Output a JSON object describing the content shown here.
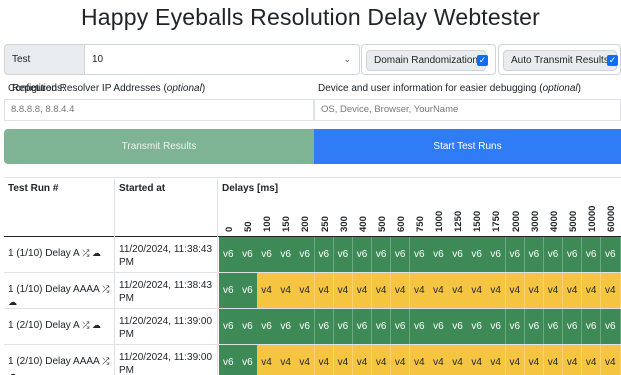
{
  "page": {
    "title": "Happy Eyeballs Resolution Delay Webtester"
  },
  "controls": {
    "repetitions_label": "Test Repetitions:",
    "repetitions_value": "10",
    "domain_randomization_label": "Domain Randomization",
    "domain_randomization_checked": true,
    "auto_transmit_label": "Auto Transmit Results",
    "auto_transmit_checked": true
  },
  "resolver": {
    "label_main": "Configured Resolver IP Addresses (",
    "label_em": "optional",
    "label_end": ")",
    "placeholder": "8.8.8.8, 8.8.4.4"
  },
  "device": {
    "label_main": "Device and user information for easier debugging (",
    "label_em": "optional",
    "label_end": ")",
    "placeholder": "OS, Device, Browser, YourName"
  },
  "actions": {
    "transmit": "Transmit Results",
    "start": "Start Test Runs"
  },
  "table": {
    "col_run": "Test Run #",
    "col_started": "Started at",
    "col_delays": "Delays [ms]",
    "delays": [
      "0",
      "50",
      "100",
      "150",
      "200",
      "250",
      "300",
      "400",
      "500",
      "600",
      "750",
      "1000",
      "1250",
      "1500",
      "1750",
      "2000",
      "3000",
      "4000",
      "5000",
      "10000",
      "60000"
    ],
    "rows": [
      {
        "run": "1 (1/10) Delay A",
        "started_date": "11/20/2024, 11:38:43",
        "started_suffix": "PM",
        "results": [
          "v6",
          "v6",
          "v6",
          "v6",
          "v6",
          "v6",
          "v6",
          "v6",
          "v6",
          "v6",
          "v6",
          "v6",
          "v6",
          "v6",
          "v6",
          "v6",
          "v6",
          "v6",
          "v6",
          "v6",
          "v6"
        ]
      },
      {
        "run": "1 (1/10) Delay AAAA",
        "started_date": "11/20/2024, 11:38:43",
        "started_suffix": "PM",
        "results": [
          "v6",
          "v6",
          "v4",
          "v4",
          "v4",
          "v4",
          "v4",
          "v4",
          "v4",
          "v4",
          "v4",
          "v4",
          "v4",
          "v4",
          "v4",
          "v4",
          "v4",
          "v4",
          "v4",
          "v4",
          "v4"
        ]
      },
      {
        "run": "1 (2/10) Delay A",
        "started_date": "11/20/2024, 11:39:00",
        "started_suffix": "PM",
        "results": [
          "v6",
          "v6",
          "v6",
          "v6",
          "v6",
          "v6",
          "v6",
          "v6",
          "v6",
          "v6",
          "v6",
          "v6",
          "v6",
          "v6",
          "v6",
          "v6",
          "v6",
          "v6",
          "v6",
          "v6",
          "v6"
        ]
      },
      {
        "run": "1 (2/10) Delay AAAA",
        "started_date": "11/20/2024, 11:39:00",
        "started_suffix": "PM",
        "results": [
          "v6",
          "v6",
          "v4",
          "v4",
          "v4",
          "v4",
          "v4",
          "v4",
          "v4",
          "v4",
          "v4",
          "v4",
          "v4",
          "v4",
          "v4",
          "v4",
          "v4",
          "v4",
          "v4",
          "v4",
          "v4"
        ]
      }
    ]
  },
  "colors": {
    "v6": "#3d8a57",
    "v4": "#f5c542",
    "primary": "#2f7cf6",
    "success_muted": "#7eb394"
  },
  "icons": [
    "shuffle-icon",
    "cloud-icon",
    "chevron-down-icon",
    "checkmark-icon"
  ]
}
